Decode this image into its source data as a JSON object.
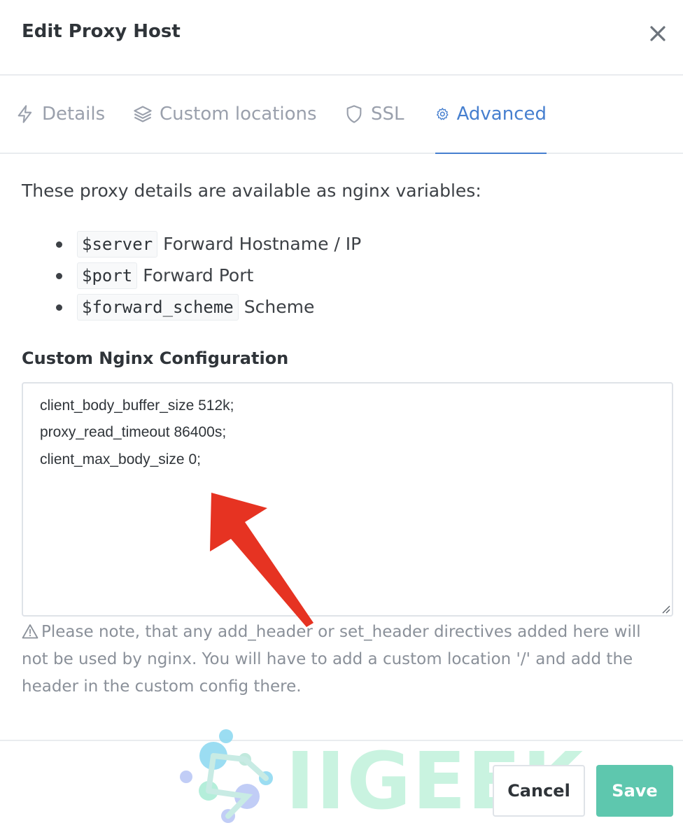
{
  "modal": {
    "title": "Edit Proxy Host",
    "close_icon": "close-icon"
  },
  "tabs": [
    {
      "label": "Details",
      "icon": "lightning-icon",
      "active": false
    },
    {
      "label": "Custom locations",
      "icon": "layers-icon",
      "active": false
    },
    {
      "label": "SSL",
      "icon": "shield-icon",
      "active": false
    },
    {
      "label": "Advanced",
      "icon": "gear-icon",
      "active": true
    }
  ],
  "advanced": {
    "intro": "These proxy details are available as nginx variables:",
    "variables": [
      {
        "code": "$server",
        "desc": "Forward Hostname / IP"
      },
      {
        "code": "$port",
        "desc": "Forward Port"
      },
      {
        "code": "$forward_scheme",
        "desc": "Scheme"
      }
    ],
    "config_label": "Custom Nginx Configuration",
    "config_lines": [
      "client_body_buffer_size 512k;",
      "proxy_read_timeout 86400s;",
      "client_max_body_size 0;"
    ],
    "note": "Please note, that any add_header or set_header directives added here will not be used by nginx. You will have to add a custom location '/' and add the header in the custom config there."
  },
  "footer": {
    "cancel_label": "Cancel",
    "save_label": "Save"
  },
  "watermark": {
    "text": "IIGEEK"
  },
  "colors": {
    "accent": "#467fcf",
    "save": "#5ec7ae",
    "annotation_arrow": "#e63322"
  }
}
